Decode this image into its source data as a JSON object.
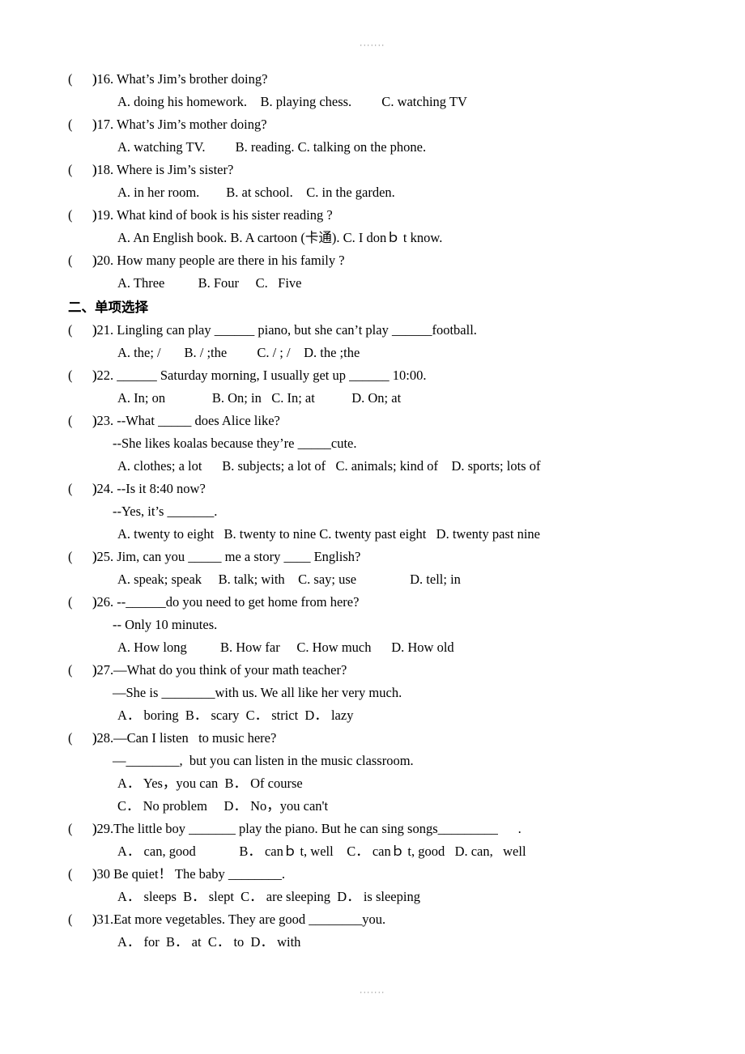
{
  "page": {
    "scan_mark_top": "·······",
    "scan_mark_bottom": "·······",
    "bracket": "(      )"
  },
  "listening_section": {
    "questions": [
      {
        "number": "16",
        "stem": ")16. What’s Jim’s brother doing?",
        "options": "A. doing his homework.    B. playing chess.         C. watching TV"
      },
      {
        "number": "17",
        "stem": ")17. What’s Jim’s mother doing?",
        "options": "A. watching TV.         B. reading. C. talking on the phone."
      },
      {
        "number": "18",
        "stem": ")18. Where is Jim’s sister?",
        "options": "A. in her room.        B. at school.    C. in the garden."
      },
      {
        "number": "19",
        "stem": ")19. What kind of book is his sister reading ?",
        "options": "A. An English book. B. A cartoon (卡通). C. I donｂ t know."
      },
      {
        "number": "20",
        "stem": ")20. How many people are there in his family ?",
        "options": "A. Three          B. Four     C.   Five"
      }
    ]
  },
  "multiple_choice_section": {
    "heading": "二、单项选择",
    "questions": [
      {
        "number": "21",
        "stem": ")21. Lingling can play ______ piano, but she can’t play ______football.",
        "lines": [],
        "options": "A. the; /       B. / ;the         C. / ; /    D. the ;the"
      },
      {
        "number": "22",
        "stem": ")22. ______ Saturday morning, I usually get up ______ 10:00.",
        "lines": [],
        "options": "A. In; on              B. On; in   C. In; at           D. On; at"
      },
      {
        "number": "23",
        "stem": ")23. --What _____ does Alice like?",
        "lines": [
          "--She likes koalas because they’re _____cute."
        ],
        "options": "A. clothes; a lot      B. subjects; a lot of   C. animals; kind of    D. sports; lots of"
      },
      {
        "number": "24",
        "stem": ")24. --Is it 8:40 now?",
        "lines": [
          "--Yes, it’s _______."
        ],
        "options": "A. twenty to eight   B. twenty to nine C. twenty past eight   D. twenty past nine"
      },
      {
        "number": "25",
        "stem": ")25. Jim, can you _____ me a story ____ English?",
        "lines": [],
        "options": "A. speak; speak     B. talk; with    C. say; use                D. tell; in"
      },
      {
        "number": "26",
        "stem": ")26. --______do you need to get home from here?",
        "lines": [
          "-- Only 10 minutes."
        ],
        "options": "A. How long          B. How far     C. How much      D. How old"
      },
      {
        "number": "27",
        "stem": ")27.—What do you think of your math teacher?",
        "lines": [
          "—She is ________with us. We all like her very much."
        ],
        "options": "A． boring  B． scary  C． strict  D． lazy"
      },
      {
        "number": "28",
        "stem": ")28.—Can I listen   to music here?",
        "lines": [
          "—________,  but you can listen in the music classroom."
        ],
        "options": "A． Yes，you can  B． Of course",
        "options2": "C． No problem     D． No，you can't"
      },
      {
        "number": "29",
        "stem": ")29.The little boy _______ play the piano. But he can sing songs_________      .",
        "lines": [],
        "options": "A． can, good             B． canｂ t, well    C． canｂ t, good   D. can,   well"
      },
      {
        "number": "30",
        "stem": ")30 Be quiet！ The baby ________.",
        "lines": [],
        "options": "A． sleeps  B． slept  C． are sleeping  D． is sleeping"
      },
      {
        "number": "31",
        "stem": ")31.Eat more vegetables. They are good ________you.",
        "lines": [],
        "options": "A． for  B． at  C． to  D． with"
      }
    ]
  }
}
